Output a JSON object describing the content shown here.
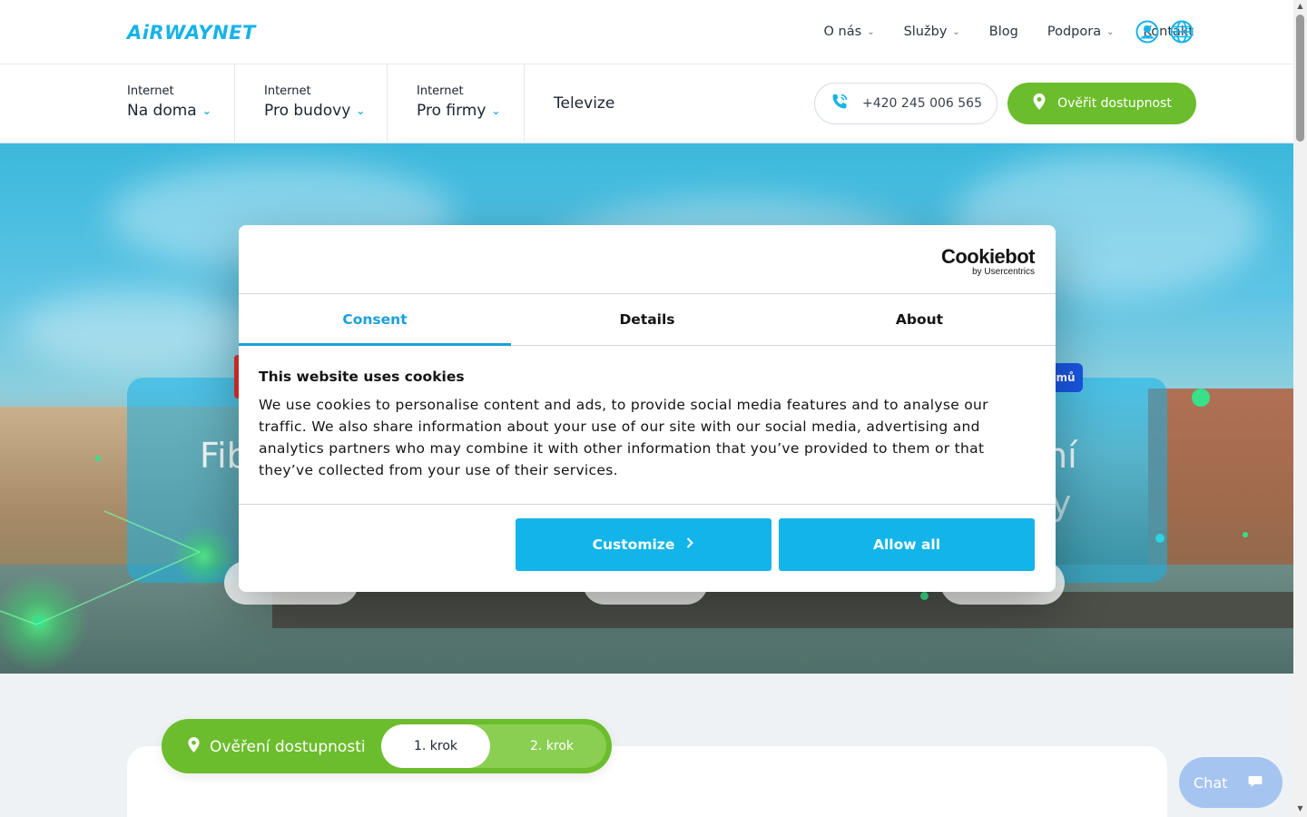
{
  "brand": {
    "logo_text": "AiRWAYNET",
    "accent": "#16b3e8",
    "green": "#6cbd2d"
  },
  "topnav": {
    "items": [
      {
        "label": "O nás",
        "has_dropdown": true
      },
      {
        "label": "Služby",
        "has_dropdown": true
      },
      {
        "label": "Blog",
        "has_dropdown": false
      },
      {
        "label": "Podpora",
        "has_dropdown": true
      },
      {
        "label": "Kontakt",
        "has_dropdown": false
      }
    ],
    "icons": [
      "user-icon",
      "globe-icon"
    ]
  },
  "subnav": {
    "segments": [
      {
        "small": "Internet",
        "big": "Na doma"
      },
      {
        "small": "Internet",
        "big": "Pro budovy"
      },
      {
        "small": "Internet",
        "big": "Pro firmy"
      }
    ],
    "tv_label": "Televize",
    "phone": "+420 245 006 565",
    "cta": "Ověřit dostupnost"
  },
  "hero": {
    "title_left": "Fib",
    "title_right": "ní",
    "title_right_line2": "y",
    "badge_text": "mů"
  },
  "cookie": {
    "provider_name": "Cookiebot",
    "provider_sub": "by Usercentrics",
    "tabs": [
      {
        "label": "Consent",
        "active": true
      },
      {
        "label": "Details",
        "active": false
      },
      {
        "label": "About",
        "active": false
      }
    ],
    "heading": "This website uses cookies",
    "body": "We use cookies to personalise content and ads, to provide social media features and to analyse our traffic. We also share information about your use of our site with our social media, advertising and analytics partners who may combine it with other information that you’ve provided to them or that they’ve collected from your use of their services.",
    "customize_label": "Customize",
    "allow_all_label": "Allow all"
  },
  "availability": {
    "label": "Ověření dostupnosti",
    "step1": "1. krok",
    "step2": "2. krok"
  },
  "chat": {
    "label": "Chat"
  }
}
